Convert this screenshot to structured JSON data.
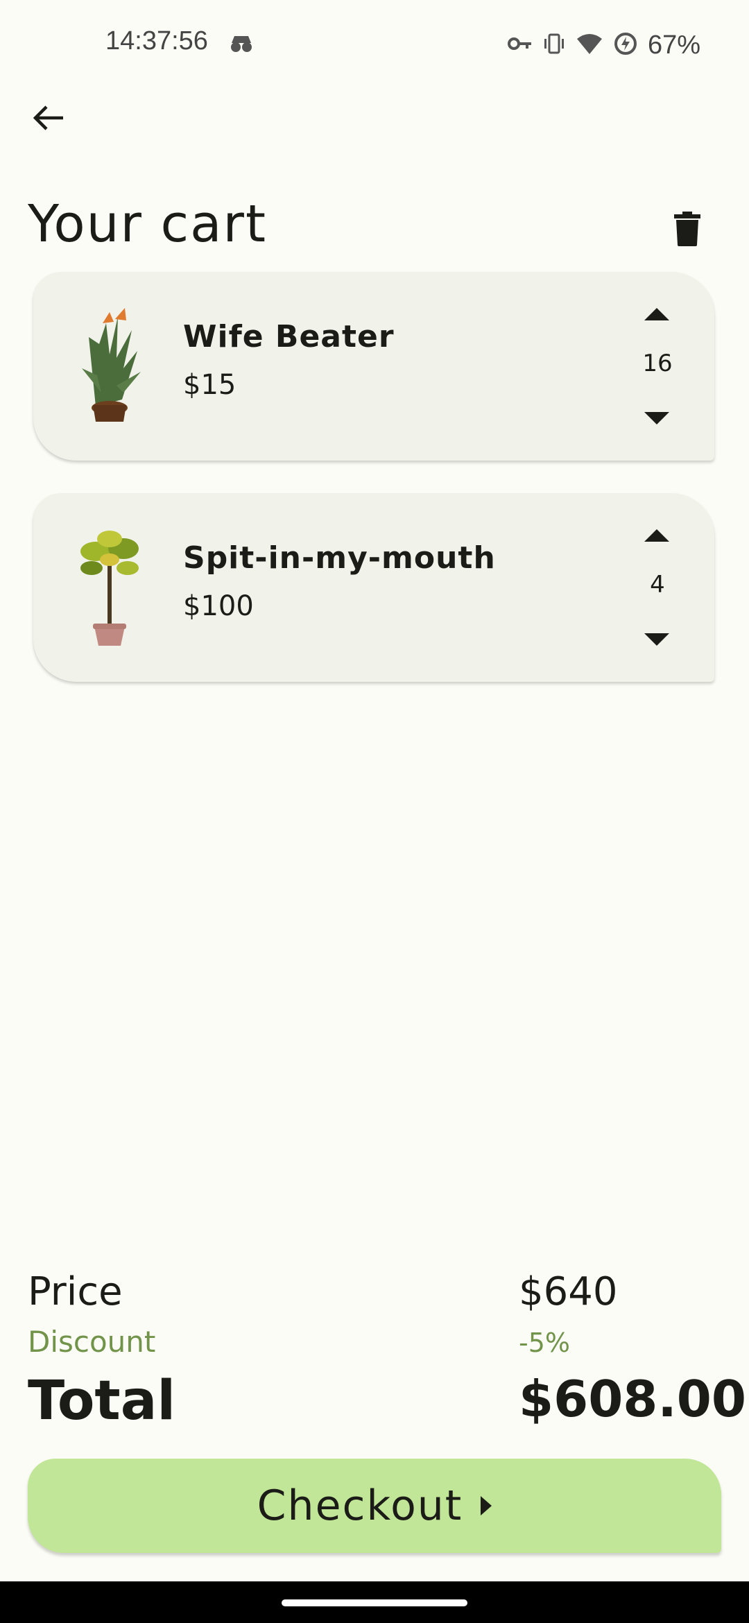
{
  "status_bar": {
    "time": "14:37:56",
    "battery": "67%",
    "icons": [
      "incognito-icon",
      "key-icon",
      "vibrate-icon",
      "wifi-icon",
      "battery-saver-icon"
    ]
  },
  "header": {
    "title": "Your cart",
    "icons": [
      "back-arrow-icon",
      "trash-icon"
    ]
  },
  "cart": {
    "items": [
      {
        "name": "Wife Beater",
        "price": "$15",
        "quantity": "16",
        "image": "plant-bird-of-paradise"
      },
      {
        "name": "Spit-in-my-mouth",
        "price": "$100",
        "quantity": "4",
        "image": "plant-croton-tree"
      }
    ]
  },
  "summary": {
    "price_label": "Price",
    "price_value": "$640",
    "discount_label": "Discount",
    "discount_value": "-5%",
    "total_label": "Total",
    "total_value": "$608.00"
  },
  "checkout": {
    "label": "Checkout"
  },
  "colors": {
    "background": "#fcfcf6",
    "card": "#f1f2ea",
    "accent_green": "#71944a",
    "checkout_button": "#c2e697",
    "text": "#1b1c17"
  }
}
